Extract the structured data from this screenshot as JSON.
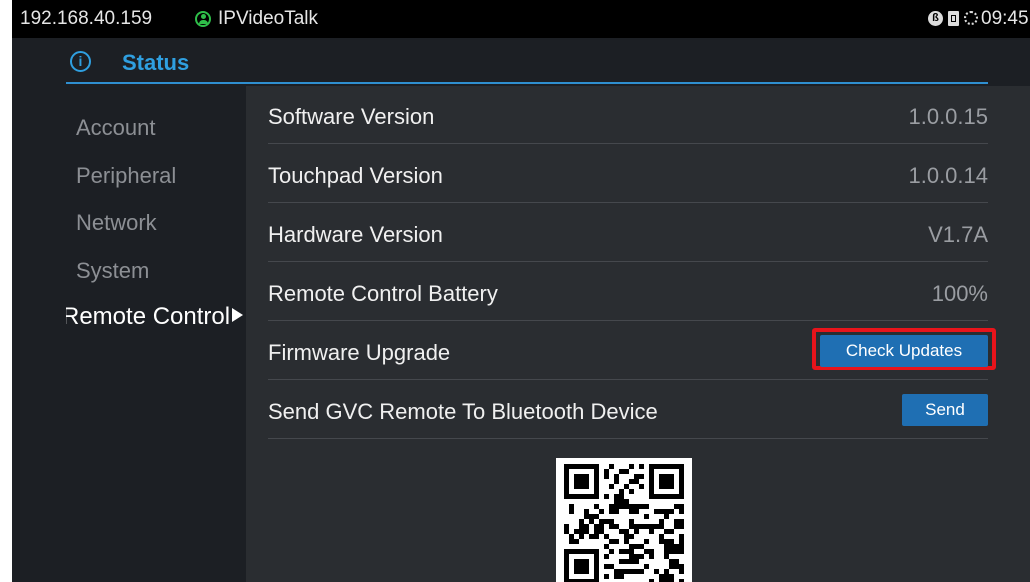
{
  "statusbar": {
    "ip": "192.168.40.159",
    "app_name": "IPVideoTalk",
    "time": "09:45",
    "icons": [
      "bluetooth-icon",
      "sim-card-icon",
      "sync-icon"
    ]
  },
  "header": {
    "title": "Status",
    "icon": "info-icon",
    "accent_color": "#2f9fe0"
  },
  "sidebar": {
    "items": [
      {
        "label": "Account"
      },
      {
        "label": "Peripheral"
      },
      {
        "label": "Network"
      },
      {
        "label": "System"
      },
      {
        "label": "Remote Control",
        "visible_text": "Remote Cor",
        "selected": true
      }
    ]
  },
  "content": {
    "rows": [
      {
        "label": "Software Version",
        "value": "1.0.0.15"
      },
      {
        "label": "Touchpad Version",
        "value": "1.0.0.14"
      },
      {
        "label": "Hardware Version",
        "value": "V1.7A"
      },
      {
        "label": "Remote Control Battery",
        "value": "100%"
      },
      {
        "label": "Firmware Upgrade",
        "button": "Check Updates"
      },
      {
        "label": "Send GVC Remote To Bluetooth Device",
        "button": "Send"
      }
    ],
    "highlight_color": "#e8141b",
    "button_color": "#1f6fb3"
  }
}
